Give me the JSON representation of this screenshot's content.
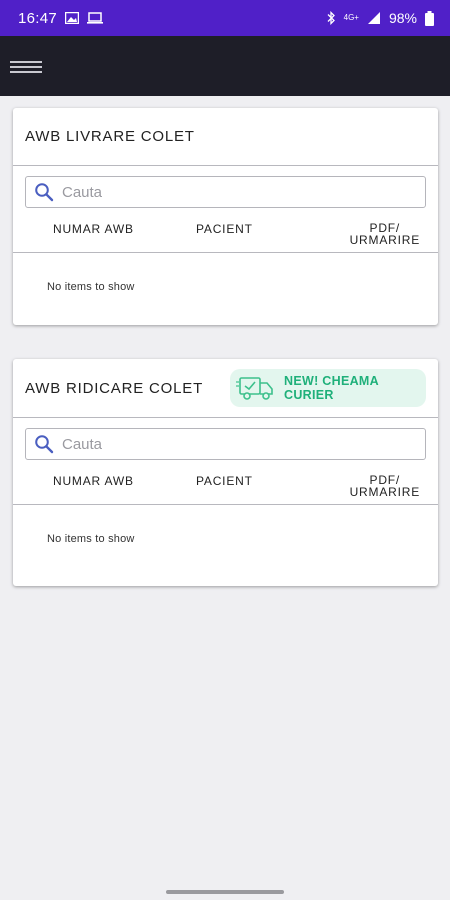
{
  "status_bar": {
    "time": "16:47",
    "battery": "98%",
    "network": "4G+",
    "icons": [
      "image-icon",
      "laptop-icon",
      "bluetooth-icon",
      "signal-icon",
      "battery-icon"
    ]
  },
  "app_bar": {
    "menu_icon": "hamburger-menu-icon"
  },
  "colors": {
    "status_bar": "#5020c8",
    "app_bar": "#1e1e28",
    "background": "#efeff2",
    "promo_bg": "#e3f6ee",
    "promo_text": "#1fb07a",
    "search_icon": "#4a5ec0"
  },
  "livrare": {
    "title": "AWB LIVRARE COLET",
    "search_placeholder": "Cauta",
    "columns": {
      "awb": "NUMAR AWB",
      "pacient": "PACIENT",
      "pdf_line1": "PDF/",
      "pdf_line2": "URMARIRE"
    },
    "empty_message": "No items to show"
  },
  "ridicare": {
    "title": "AWB RIDICARE COLET",
    "promo": {
      "line1": "NEW! CHEAMA",
      "line2": "CURIER",
      "icon": "delivery-truck-icon"
    },
    "search_placeholder": "Cauta",
    "columns": {
      "awb": "NUMAR AWB",
      "pacient": "PACIENT",
      "pdf_line1": "PDF/",
      "pdf_line2": "URMARIRE"
    },
    "empty_message": "No items to show"
  }
}
